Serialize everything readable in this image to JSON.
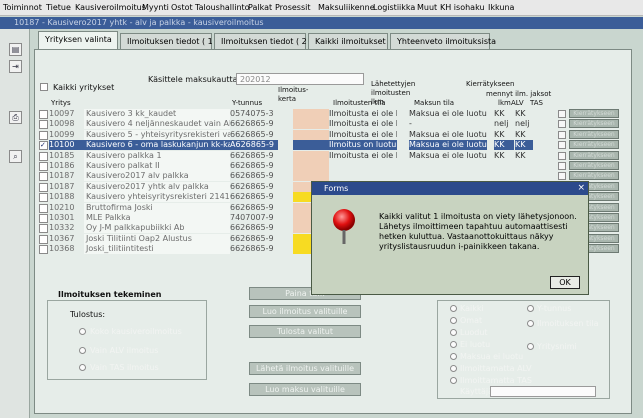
{
  "menu": [
    "Toiminnot",
    "Tietue",
    "Kausiveroilmoitus",
    "Myynti",
    "Ostot",
    "Taloushallinto",
    "Palkat",
    "Prosessit",
    "Maksuliikenne",
    "Logistiikka",
    "Muut",
    "KH isohaku",
    "Ikkuna"
  ],
  "window_title": "10187 - Kausivero2017 yhtk - alv ja palkka - kausiveroilmoitus",
  "tabs": [
    "Yrityksen valinta",
    "Ilmoituksen tiedot ( 1 )",
    "Ilmoituksen tiedot ( 2 )",
    "Kaikki ilmoitukset",
    "Yhteenveto ilmoituksista"
  ],
  "filter": {
    "all_companies_label": "Kaikki yritykset",
    "period_label": "Käsittele maksukautta:",
    "period_value": "202012"
  },
  "columns": {
    "yritys": "Yritys",
    "ytunnus": "Y-tunnus",
    "ilmoitus_kerta": "Ilmoitus-\nkerta",
    "ilmoitusten_tila": "Ilmoitusten tila",
    "lahetettyjen_lkm": "Lähetettyjen\nilmoitusten\nlkm",
    "maksun_tila": "Maksun tila",
    "kierratykseen": "Kierrätykseen",
    "menneyt": "mennyt ilm. jaksot",
    "lkm": "lkm",
    "alv": "ALV",
    "tas": "TAS"
  },
  "rows": [
    {
      "nro": "10097",
      "name": "Kausivero 3 kk_kaudet",
      "ytunnus": "0574075-3",
      "tila": "Ilmoitusta ei ole luotu",
      "maksu": "Maksua ei ole luotu",
      "alv": "KK",
      "tas": "KK",
      "selected": false,
      "highlight": false
    },
    {
      "nro": "10098",
      "name": "Kausivero 4 neljänneskaudet vain ALV",
      "ytunnus": "6626865-9",
      "tila": "Ilmoitusta ei ole luotu",
      "maksu": "-",
      "alv": "nelj",
      "tas": "nelj",
      "selected": false,
      "highlight": false
    },
    {
      "nro": "10099",
      "name": "Kausivero 5 - yhteisyritysrekisteri vain ALV",
      "ytunnus": "6626865-9",
      "tila": "Ilmoitusta ei ole luotu",
      "maksu": "Maksua ei ole luotu",
      "alv": "KK",
      "tas": "KK",
      "selected": false,
      "highlight": false
    },
    {
      "nro": "10100",
      "name": "Kausivero 6 - oma laskukanjun kk-kaudet",
      "ytunnus": "A626865-9",
      "tila": "Ilmoitus on luotu",
      "maksu": "Maksua ei ole luotu",
      "alv": "KK",
      "tas": "KK",
      "selected": true,
      "highlight": false
    },
    {
      "nro": "10185",
      "name": "Kausivero palkka 1",
      "ytunnus": "6626865-9",
      "tila": "Ilmoitusta ei ole luotu",
      "maksu": "Maksua ei ole luotu",
      "alv": "KK",
      "tas": "KK",
      "selected": false,
      "highlight": false
    },
    {
      "nro": "10186",
      "name": "Kausivero palkat II",
      "ytunnus": "6626865-9",
      "tila": "",
      "maksu": "",
      "alv": "",
      "tas": "",
      "selected": false,
      "highlight": false
    },
    {
      "nro": "10187",
      "name": "Kausivero2017 alv palkka",
      "ytunnus": "6626865-9",
      "tila": "",
      "maksu": "",
      "alv": "",
      "tas": "",
      "selected": false,
      "highlight": false
    },
    {
      "nro": "10187",
      "name": "Kausivero2017 yhtk alv palkka",
      "ytunnus": "6626865-9",
      "tila": "",
      "maksu": "",
      "alv": "",
      "tas": "",
      "selected": false,
      "highlight": false
    },
    {
      "nro": "10188",
      "name": "Kausivero yhteisyritysrekisteri 2141",
      "ytunnus": "6626865-9",
      "tila": "",
      "maksu": "",
      "alv": "",
      "tas": "",
      "selected": false,
      "highlight": true
    },
    {
      "nro": "10210",
      "name": "Bruttofirma Joski",
      "ytunnus": "6626865-9",
      "tila": "",
      "maksu": "",
      "alv": "",
      "tas": "",
      "selected": false,
      "highlight": false
    },
    {
      "nro": "10301",
      "name": "MLE Palkka",
      "ytunnus": "7407007-9",
      "tila": "",
      "maksu": "",
      "alv": "",
      "tas": "",
      "selected": false,
      "highlight": false
    },
    {
      "nro": "10332",
      "name": "Oy J-M palkkapubiikki Ab",
      "ytunnus": "6626865-9",
      "tila": "",
      "maksu": "",
      "alv": "",
      "tas": "",
      "selected": false,
      "highlight": false
    },
    {
      "nro": "10367",
      "name": "Joski Tilitiinti Oap2 Alustus",
      "ytunnus": "6626865-9",
      "tila": "",
      "maksu": "",
      "alv": "",
      "tas": "",
      "selected": false,
      "highlight": true
    },
    {
      "nro": "10368",
      "name": "Joski_tilitiintitesti",
      "ytunnus": "6626865-9",
      "tila": "",
      "maksu": "",
      "alv": "",
      "tas": "",
      "selected": false,
      "highlight": true
    }
  ],
  "kierratys_label": "Kierrätykseen",
  "bottom": {
    "section_title": "Ilmoituksen tekeminen",
    "tulostus_label": "Tulostus:",
    "radios_left": [
      "Koko kausiveroilmoitus",
      "Vain ALV ilmoitus",
      "Vain TAS ilmoitus"
    ],
    "buttons": [
      "Paina tä...",
      "Luo ilmoitus valituille",
      "Tulosta valitut",
      "Lähetä ilmoitus valituille",
      "Luo maksu valituille"
    ],
    "radios_right_a": [
      "Kaikki",
      "Omat",
      "Luodut",
      "Ei luotu",
      "Maksua ei luotu",
      "Ilmoittamatta ALV",
      "Ilmoittamatta TAS"
    ],
    "radios_right_b": [
      "Y-tunnus",
      "Ilmoituksen tila",
      "Yritysnimi"
    ],
    "kayttaja_label": "Käyttäjä"
  },
  "modal": {
    "title": "Forms",
    "close": "×",
    "message": "Kaikki valitut 1 ilmoitusta on viety lähetysjonoon. Lähetys ilmoittimeen tapahtuu automaattisesti hetken kuluttua. Vastaanottokuittaus näkyy yrityslistausruudun i-painikkeen takana.",
    "ok": "OK"
  },
  "colors": {
    "selection": "#3b5d98",
    "highlight": "#f7db22",
    "modal_title": "#2c4a8c"
  },
  "icons": [
    "save-icon",
    "exit-icon",
    "print-icon",
    "search-icon",
    "error-icon"
  ]
}
